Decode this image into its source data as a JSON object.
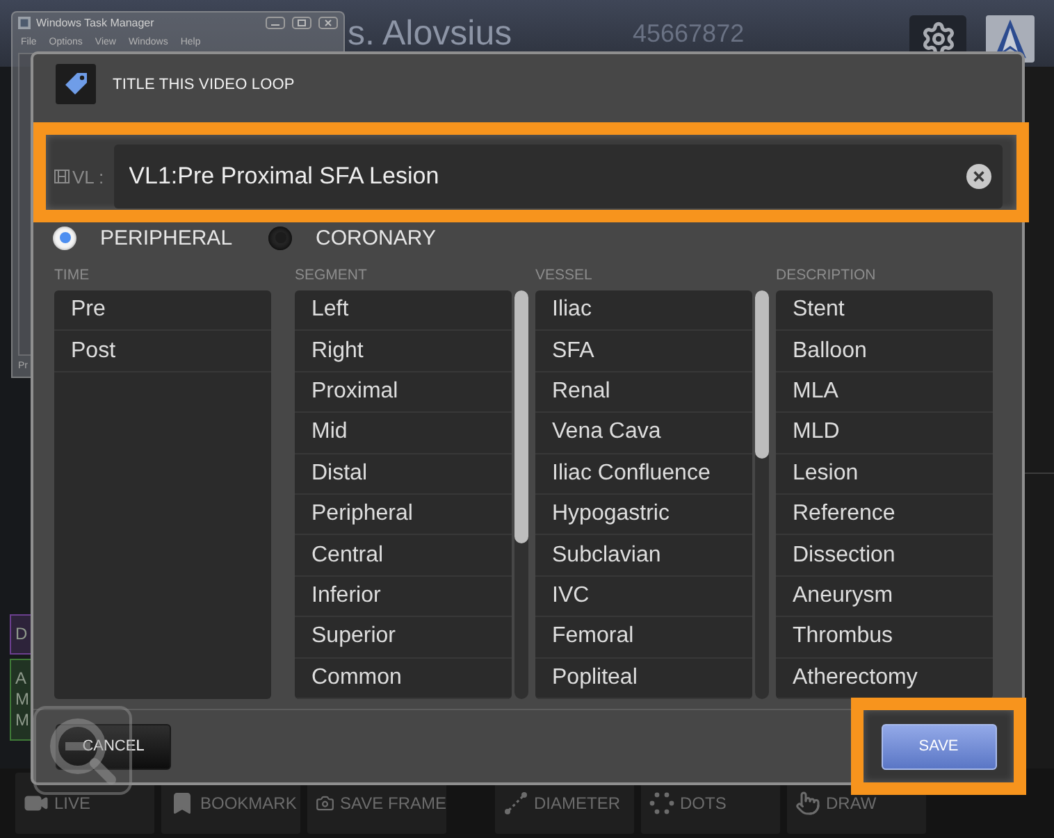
{
  "background": {
    "task_manager": {
      "title": "Windows Task Manager",
      "menu": [
        "File",
        "Options",
        "View",
        "Windows",
        "Help"
      ],
      "status": "Pr"
    },
    "patient_name": "s. Alovsius",
    "patient_id": "45667872",
    "side_tags": [
      {
        "lines": [
          "D"
        ],
        "color": "#6b3f8f"
      },
      {
        "lines": [
          "A",
          "M",
          "M"
        ],
        "color": "#3f7a37"
      }
    ],
    "toolbar_groups": [
      [
        "LIVE",
        "BOOKMARK",
        "SAVE FRAME"
      ],
      [
        "DIAMETER",
        "DOTS",
        "DRAW"
      ]
    ]
  },
  "dialog": {
    "title": "TITLE THIS VIDEO LOOP",
    "field": {
      "label": "VL :",
      "value": "VL1:Pre Proximal SFA Lesion",
      "highlighted": true
    },
    "modes": [
      {
        "label": "PERIPHERAL",
        "selected": true
      },
      {
        "label": "CORONARY",
        "selected": false
      }
    ],
    "lists": [
      {
        "heading": "TIME",
        "items": [
          "Pre",
          "Post"
        ]
      },
      {
        "heading": "SEGMENT",
        "items": [
          "Left",
          "Right",
          "Proximal",
          "Mid",
          "Distal",
          "Peripheral",
          "Central",
          "Inferior",
          "Superior",
          "Common"
        ]
      },
      {
        "heading": "VESSEL",
        "items": [
          "Iliac",
          "SFA",
          "Renal",
          "Vena Cava",
          "Iliac Confluence",
          "Hypogastric",
          "Subclavian",
          "IVC",
          "Femoral",
          "Popliteal"
        ]
      },
      {
        "heading": "DESCRIPTION",
        "items": [
          "Stent",
          "Balloon",
          "MLA",
          "MLD",
          "Lesion",
          "Reference",
          "Dissection",
          "Aneurysm",
          "Thrombus",
          "Atherectomy"
        ]
      }
    ],
    "buttons": [
      {
        "label": "CANCEL",
        "kind": "cancel",
        "highlighted": false
      },
      {
        "label": "SAVE",
        "kind": "save",
        "highlighted": true
      }
    ]
  }
}
